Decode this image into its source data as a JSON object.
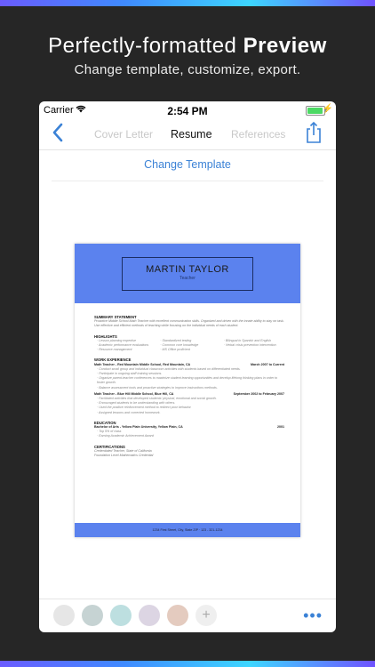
{
  "hero": {
    "title_normal": "Perfectly-formatted ",
    "title_bold": "Preview",
    "subtitle": "Change template, customize, export."
  },
  "status": {
    "carrier": "Carrier",
    "time": "2:54 PM"
  },
  "nav": {
    "tabs": [
      "Cover Letter",
      "Resume",
      "References"
    ],
    "active_tab": "Resume"
  },
  "change_template": "Change Template",
  "resume": {
    "name": "MARTIN TAYLOR",
    "role": "Teacher",
    "summary_title": "SUMMARY STATEMENT",
    "summary_text": "Proactive Middle School Math Teacher with excellent communication skills. Organized and driven with the innate ability to stay on task. Use effective and efficient methods of teaching while focusing on the individual needs of each student.",
    "highlights_title": "HIGHLIGHTS",
    "highlights": [
      [
        "Lesson planning expertise",
        "Academic performance evaluations",
        "Resource management"
      ],
      [
        "Standardized testing",
        "Common core knowledge",
        "MS Office proficient"
      ],
      [
        "Bilingual in Spanish and English",
        "Verbal crisis prevention intervention"
      ]
    ],
    "work_title": "WORK EXPERIENCE",
    "jobs": [
      {
        "title": "Math Teacher - Red Mountain Middle School, Red Mountain, CA",
        "dates": "March 2007 to Current",
        "bullets": [
          "Conduct small group and individual classroom activities with students based on differentiated needs.",
          "Participate in ongoing staff training sessions.",
          "Organize parent-teacher conferences to maximize student learning opportunities and develop lifelong thinking plans in order to foster growth.",
          "Balance assessment tools and proactive strategies to improve instructions methods."
        ]
      },
      {
        "title": "Math Teacher - Blue Hill Middle School, Blue Hill, CA",
        "dates": "September 2002 to February 2007",
        "bullets": [
          "Facilitated activities that developed students' physical, emotional and social growth.",
          "Encouraged students to be understanding with others.",
          "Used the positive reinforcement method to redirect poor behavior.",
          "Assigned lessons and corrected homework."
        ]
      }
    ],
    "education_title": "EDUCATION",
    "degree": "Bachelor of Arts - Yellow Plain University, Yellow Plain, CA",
    "degree_year": "2001",
    "edu_bullets": [
      "Top 5% of class",
      "Earning Academic Achievement Award"
    ],
    "cert_title": "CERTIFICATIONS",
    "certs": [
      "Credentialed Teacher, State of California",
      "Foundation Level Mathematics Credential"
    ],
    "footer": "1234 First Street, City, State ZIP · 123 - 321-1234"
  },
  "swatch_colors": [
    "#e6e6e6",
    "#c6d3d3",
    "#bddfe0",
    "#dcd5e3",
    "#e4cbbf"
  ],
  "add_symbol": "+",
  "more_symbol": "•••",
  "accent": "#3b82d6",
  "resume_header_color": "#5b82ee"
}
